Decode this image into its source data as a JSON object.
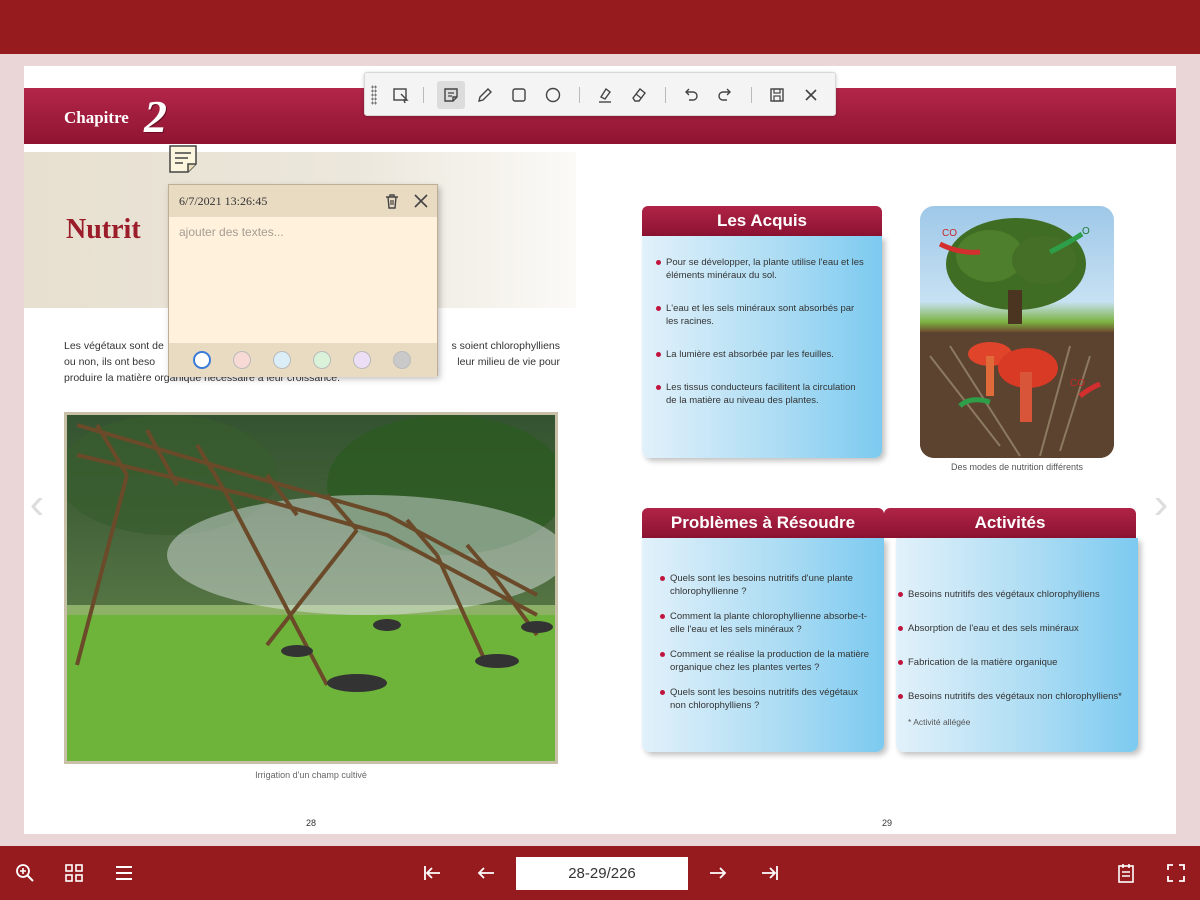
{
  "colors": {
    "brand": "#951b1e",
    "accent_magenta": "#a61e3e",
    "bullet": "#c0143c",
    "box_blue": "#7ccaf0"
  },
  "toolbar": {
    "tools": [
      {
        "name": "select-icon"
      },
      {
        "name": "note-icon",
        "active": true
      },
      {
        "name": "pencil-icon"
      },
      {
        "name": "rectangle-icon"
      },
      {
        "name": "circle-icon"
      },
      {
        "name": "highlighter-icon"
      },
      {
        "name": "eraser-icon"
      },
      {
        "name": "undo-icon"
      },
      {
        "name": "redo-icon"
      },
      {
        "name": "save-icon"
      },
      {
        "name": "close-icon"
      }
    ]
  },
  "note": {
    "date": "6/7/2021 13:26:45",
    "placeholder": "ajouter des textes...",
    "colors": [
      "#ffffff",
      "#f7d9d6",
      "#dbeef7",
      "#d9f2d9",
      "#ecdff5",
      "#c9c9c9"
    ],
    "selected_color": 0
  },
  "left_page": {
    "chapter_label": "Chapitre",
    "chapter_number": "2",
    "title": "Nutrit",
    "intro_lines": [
      "Les végétaux sont de",
      "s soient chlorophylliens",
      "ou non, ils ont beso",
      "leur milieu de vie pour",
      "produire la matière organique nécessaire à leur croissance."
    ],
    "photo_caption": "Irrigation d'un champ cultivé",
    "page_number": "28"
  },
  "right_page": {
    "acquis": {
      "title": "Les Acquis",
      "items": [
        "Pour se développer, la plante utilise l'eau et les éléments minéraux du sol.",
        "L'eau et les sels minéraux sont absorbés par les racines.",
        "La lumière est absorbée par les feuilles.",
        "Les tissus conducteurs facilitent la circulation de la matière au niveau des plantes."
      ]
    },
    "image_caption": "Des modes de nutrition différents",
    "image_labels": {
      "co2_left": "CO",
      "o2": "O",
      "co2_right": "CO"
    },
    "problemes": {
      "title": "Problèmes à Résoudre",
      "items": [
        "Quels sont les besoins nutritifs d'une plante chlorophyllienne ?",
        "Comment la plante chlorophyllienne absorbe-t-elle l'eau et les sels minéraux ?",
        "Comment se réalise la production de la matière organique chez les plantes vertes ?",
        "Quels sont les besoins nutritifs des végétaux non chlorophylliens ?"
      ]
    },
    "activites": {
      "title": "Activités",
      "items": [
        "Besoins nutritifs des végétaux chlorophylliens",
        "Absorption de l'eau et des sels minéraux",
        "Fabrication de la matière organique",
        "Besoins nutritifs des végétaux non chlorophylliens*"
      ],
      "note": "* Activité allégée"
    },
    "page_number": "29"
  },
  "bottom_bar": {
    "page_indicator": "28-29/226",
    "left_icons": [
      "zoom-icon",
      "thumbnails-icon",
      "menu-icon"
    ],
    "nav_icons": [
      "first-page-icon",
      "prev-page-icon",
      "next-page-icon",
      "last-page-icon"
    ],
    "right_icons": [
      "notes-icon",
      "fullscreen-icon"
    ]
  }
}
